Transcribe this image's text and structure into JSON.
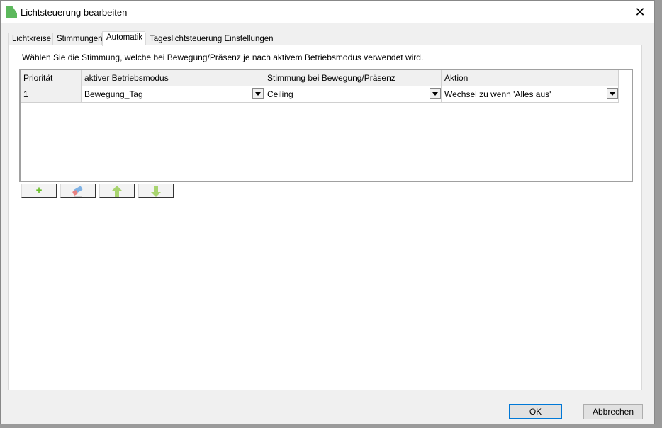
{
  "window": {
    "title": "Lichtsteuerung bearbeiten"
  },
  "tabs": [
    {
      "label": "Lichtkreise"
    },
    {
      "label": "Stimmungen"
    },
    {
      "label": "Automatik"
    },
    {
      "label": "Tageslichtsteuerung Einstellungen"
    }
  ],
  "active_tab": "Automatik",
  "description": "Wählen Sie die Stimmung, welche bei Bewegung/Präsenz je nach aktivem Betriebsmodus verwendet wird.",
  "table": {
    "columns": [
      "Priorität",
      "aktiver Betriebsmodus",
      "Stimmung bei Bewegung/Präsenz",
      "Aktion"
    ],
    "rows": [
      {
        "prio": "1",
        "modus": "Bewegung_Tag",
        "stimmung": "Ceiling",
        "aktion": "Wechsel zu wenn 'Alles aus'"
      }
    ]
  },
  "toolbar": {
    "add": "+"
  },
  "buttons": {
    "ok": "OK",
    "cancel": "Abbrechen"
  },
  "colors": {
    "accent": "#0078d7",
    "add": "#6abf2a",
    "arrows": "#a8d46f"
  }
}
